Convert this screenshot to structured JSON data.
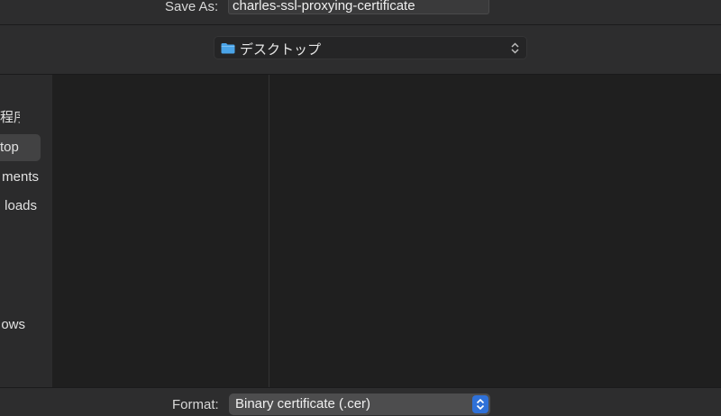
{
  "save_dialog": {
    "save_as_label": "Save As:",
    "file_name": "charles-ssl-proxying-certificate",
    "location": {
      "icon": "folder-icon",
      "label": "デスクトップ",
      "accent_color": "#4aa4e8"
    },
    "sidebar": {
      "items": [
        {
          "label": "程序",
          "selected": false
        },
        {
          "label": "top",
          "selected": true
        },
        {
          "label": "ments",
          "selected": false
        },
        {
          "label": "loads",
          "selected": false
        },
        {
          "label": "ows",
          "selected": false
        }
      ]
    },
    "format": {
      "label": "Format:",
      "value": "Binary certificate (.cer)",
      "stepper_color": "#2f71d8"
    }
  }
}
